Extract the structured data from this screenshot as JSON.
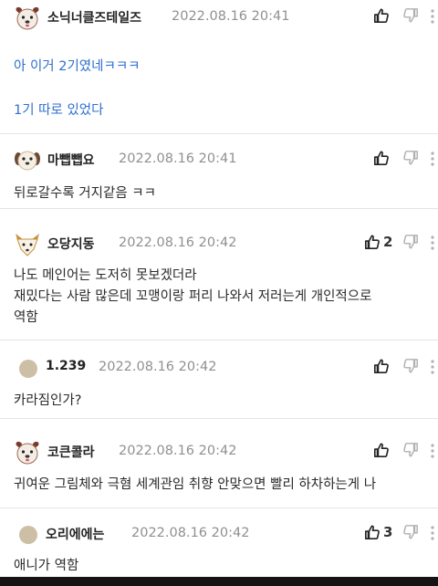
{
  "comments": [
    {
      "author": "소닉너클즈테일즈",
      "date": "2022.08.16 20:41",
      "like_count": "",
      "lines": [
        "아 이거 2기였네ㅋㅋㅋ",
        "1기 따로 있었다"
      ]
    },
    {
      "author": "마뺍뺍요",
      "date": "2022.08.16 20:41",
      "like_count": "",
      "lines": [
        "뒤로갈수록 거지같음 ㅋㅋ"
      ]
    },
    {
      "author": "오당지동",
      "date": "2022.08.16 20:42",
      "like_count": "2",
      "lines": [
        "나도 메인어는 도저히 못보겠더라",
        "재밌다는 사람 많은데 꼬맹이랑 퍼리 나와서 저러는게 개인적으로 ",
        "역함"
      ]
    },
    {
      "author": "1.239",
      "date": "2022.08.16 20:42",
      "like_count": "",
      "lines": [
        "카라짐인가?"
      ]
    },
    {
      "author": "코큰콜라",
      "date": "2022.08.16 20:42",
      "like_count": "",
      "lines": [
        "귀여운 그림체와 극혐 세계관임 취향 안맞으면 빨리 하차하는게 나"
      ]
    },
    {
      "author": "오리에에는",
      "date": "2022.08.16 20:42",
      "like_count": "3",
      "lines": [
        "애니가 역함"
      ]
    }
  ],
  "colors": {
    "link_text": "#2f6fcf",
    "date_text": "#909090",
    "divider": "#e4e4e4"
  },
  "icons": {
    "like": "thumbs-up-icon",
    "dislike": "thumbs-down-icon",
    "more": "more-vertical-icon"
  }
}
